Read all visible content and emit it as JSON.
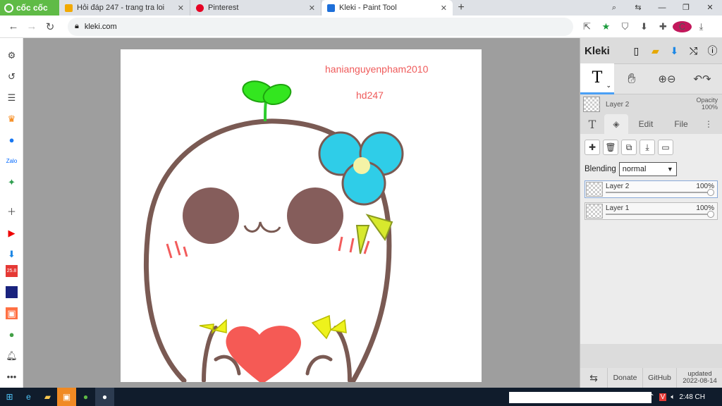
{
  "browser": {
    "brand": "cốc cốc",
    "tabs": [
      {
        "title": "Hỏi đáp 247 - trang tra loi",
        "color": "#f2a900"
      },
      {
        "title": "Pinterest",
        "color": "#e60023"
      },
      {
        "title": "Kleki - Paint Tool",
        "color": "#1e6fd9"
      }
    ],
    "new_tab": "+",
    "address": "kleki.com"
  },
  "canvas": {
    "watermark_1": "hanianguyenpham2010",
    "watermark_2": "hd247"
  },
  "kleki": {
    "logo": "Kleki",
    "tool_glyph": "T",
    "tool_caret": "⌄",
    "current_layer": "Layer 2",
    "opacity_label": "Opacity",
    "opacity_value": "100%",
    "tabs": {
      "edit": "Edit",
      "file": "File"
    },
    "blending_label": "Blending",
    "blending_value": "normal",
    "layers": [
      {
        "name": "Layer 2",
        "opacity": "100%",
        "selected": true
      },
      {
        "name": "Layer 1",
        "opacity": "100%",
        "selected": false
      }
    ],
    "footer": {
      "donate": "Donate",
      "github": "GitHub",
      "updated_label": "updated",
      "updated_date": "2022-08-14"
    }
  },
  "taskbar": {
    "clock": "2:48 CH"
  },
  "colors": {
    "chrome_green": "#5fbb46",
    "panel_bg": "#dcdcdc",
    "canvas_bg": "#9e9e9e",
    "accent_blue": "#4a9ff5"
  }
}
